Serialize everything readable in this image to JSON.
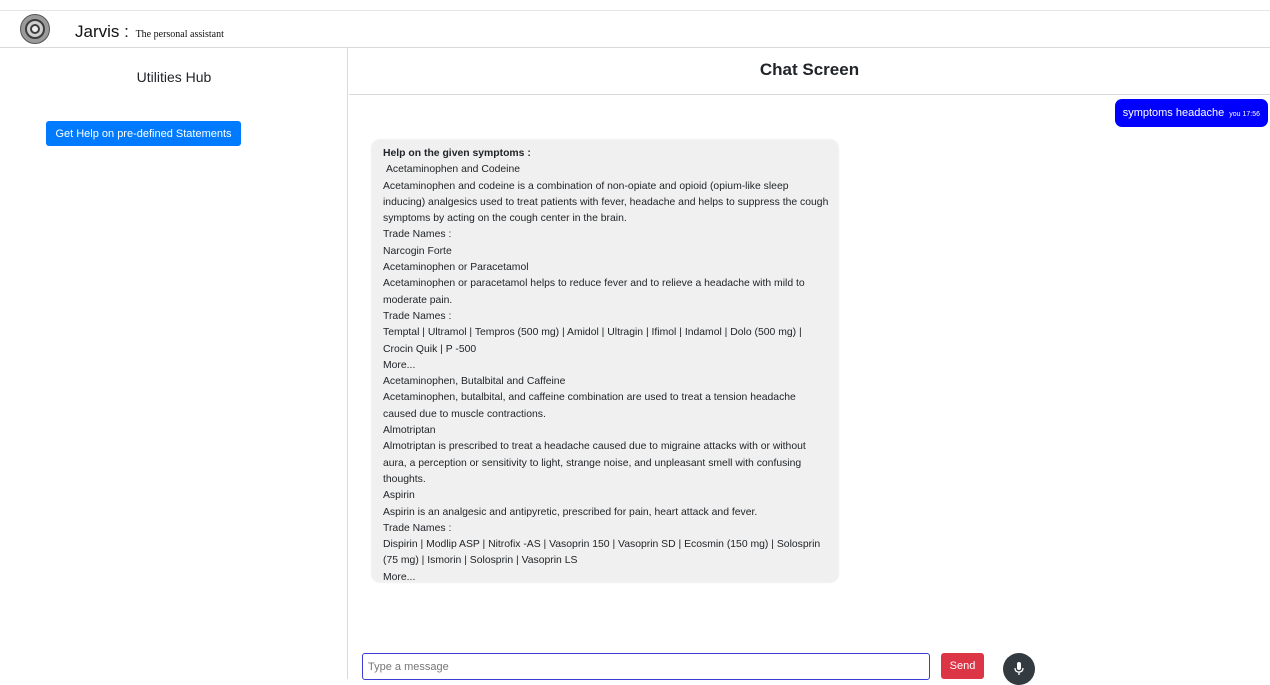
{
  "app": {
    "name": "Jarvis :",
    "subtitle": "The personal assistant"
  },
  "sidebar": {
    "title": "Utilities Hub",
    "help_button_label": "Get Help on pre-defined Statements"
  },
  "chat": {
    "title": "Chat Screen",
    "user_message": {
      "text": "symptoms headache",
      "meta": "you 17:56"
    },
    "bot_message": {
      "heading": "Help on the given symptoms :",
      "lines": [
        " Acetaminophen and Codeine",
        "Acetaminophen and codeine is a combination of non-opiate and opioid (opium-like sleep inducing) analgesics used to treat patients with fever, headache and helps to suppress the cough symptoms by acting on the cough center in the brain.",
        "Trade Names :",
        "Narcogin Forte",
        "Acetaminophen or Paracetamol",
        "Acetaminophen or paracetamol helps to reduce fever and to relieve a headache with mild to moderate pain.",
        "Trade Names :",
        "Temptal | Ultramol | Tempros (500 mg) | Amidol | Ultragin | Ifimol | Indamol | Dolo (500 mg) | Crocin Quik | P -500",
        "More...",
        "Acetaminophen, Butalbital and Caffeine",
        "Acetaminophen, butalbital, and caffeine combination are used to treat a tension headache caused due to muscle contractions.",
        "Almotriptan",
        "Almotriptan is prescribed to treat a headache caused due to migraine attacks with or without aura, a perception or sensitivity to light, strange noise, and unpleasant smell with confusing thoughts.",
        "Aspirin",
        "Aspirin is an analgesic and antipyretic, prescribed for pain, heart attack and fever.",
        "Trade Names :",
        "Dispirin | Modlip ASP | Nitrofix -AS | Vasoprin 150 | Vasoprin SD | Ecosmin (150 mg) | Solosprin (75 mg) | Ismorin | Solosprin | Vasoprin LS",
        "More..."
      ]
    }
  },
  "composer": {
    "placeholder": "Type a message",
    "value": "",
    "send_label": "Send"
  },
  "icons": {
    "logo": "emblem-logo",
    "mic": "microphone-icon"
  },
  "colors": {
    "primary_button": "#007bff",
    "user_bubble": "#0000ff",
    "send_button": "#dc3545",
    "mic_button": "#333a40",
    "bot_bubble": "#f0f0f0"
  }
}
